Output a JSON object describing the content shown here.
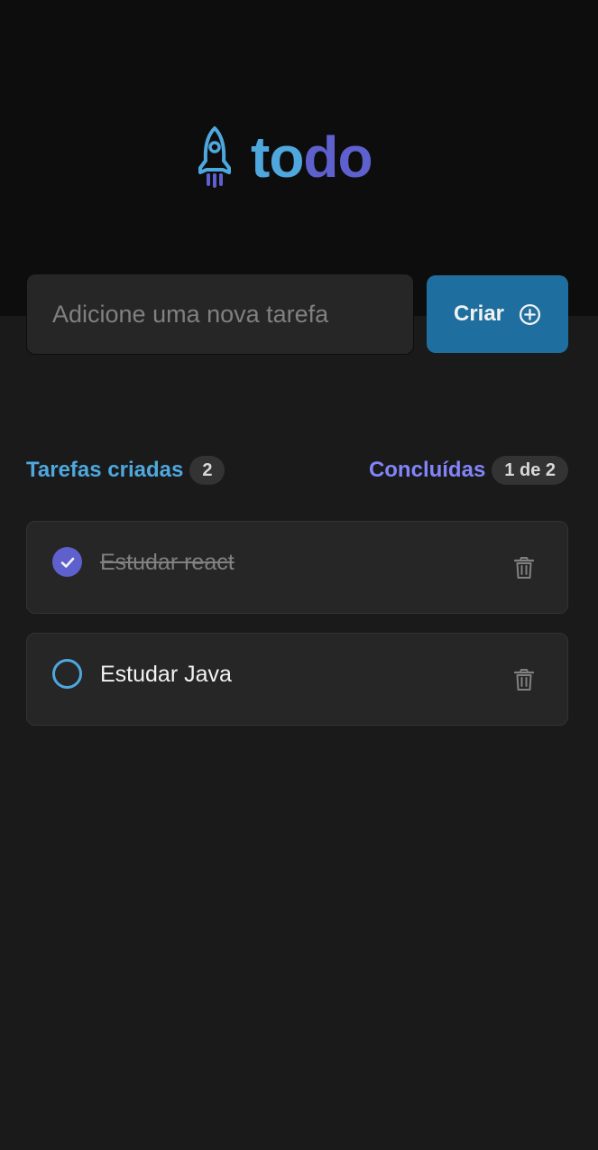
{
  "app": {
    "logo": {
      "part1": "to",
      "part2": "do"
    }
  },
  "new_task": {
    "placeholder": "Adicione uma nova tarefa",
    "value": "",
    "create_label": "Criar"
  },
  "summary": {
    "created_label": "Tarefas criadas",
    "created_count": "2",
    "done_label": "Concluídas",
    "done_count": "1 de 2"
  },
  "tasks": [
    {
      "text": "Estudar react",
      "completed": true
    },
    {
      "text": "Estudar Java",
      "completed": false
    }
  ],
  "icons": {
    "logo": "rocket-icon",
    "create": "plus-circle-icon",
    "check": "check-icon",
    "delete": "trash-icon"
  },
  "colors": {
    "background": "#1a1a1a",
    "header": "#0d0d0d",
    "blue": "#4ea8de",
    "blue_dark": "#1e6f9f",
    "purple": "#5e60ce",
    "purple_light": "#8284fa",
    "surface": "#262626"
  }
}
